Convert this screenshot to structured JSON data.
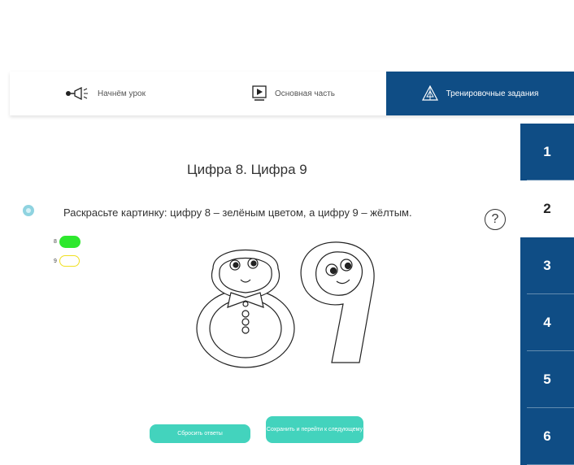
{
  "colors": {
    "accent": "#0f4d85",
    "button": "#43d3bd",
    "green": "#2ee82e",
    "yellow": "#f0e020"
  },
  "nav": {
    "tabs": [
      {
        "label": "Начнём урок",
        "icon": "megaphone-icon"
      },
      {
        "label": "Основная часть",
        "icon": "play-icon"
      },
      {
        "label": "Тренировочные задания",
        "icon": "pyramid-icon"
      }
    ],
    "active_tab": 2
  },
  "sidebar": {
    "items": [
      "1",
      "2",
      "3",
      "4",
      "5",
      "6"
    ],
    "active_index": 1
  },
  "lesson": {
    "title": "Цифра 8. Цифра 9",
    "task": "Раскрасьте картинку: цифру 8 – зелёным цветом, а цифру 9 – жёлтым.",
    "help": "?"
  },
  "legend": [
    {
      "label": "8",
      "color": "green"
    },
    {
      "label": "9",
      "color": "yellow"
    }
  ],
  "buttons": {
    "reset": "Сбросить ответы",
    "save": "Сохранить и перейти к следующему"
  }
}
